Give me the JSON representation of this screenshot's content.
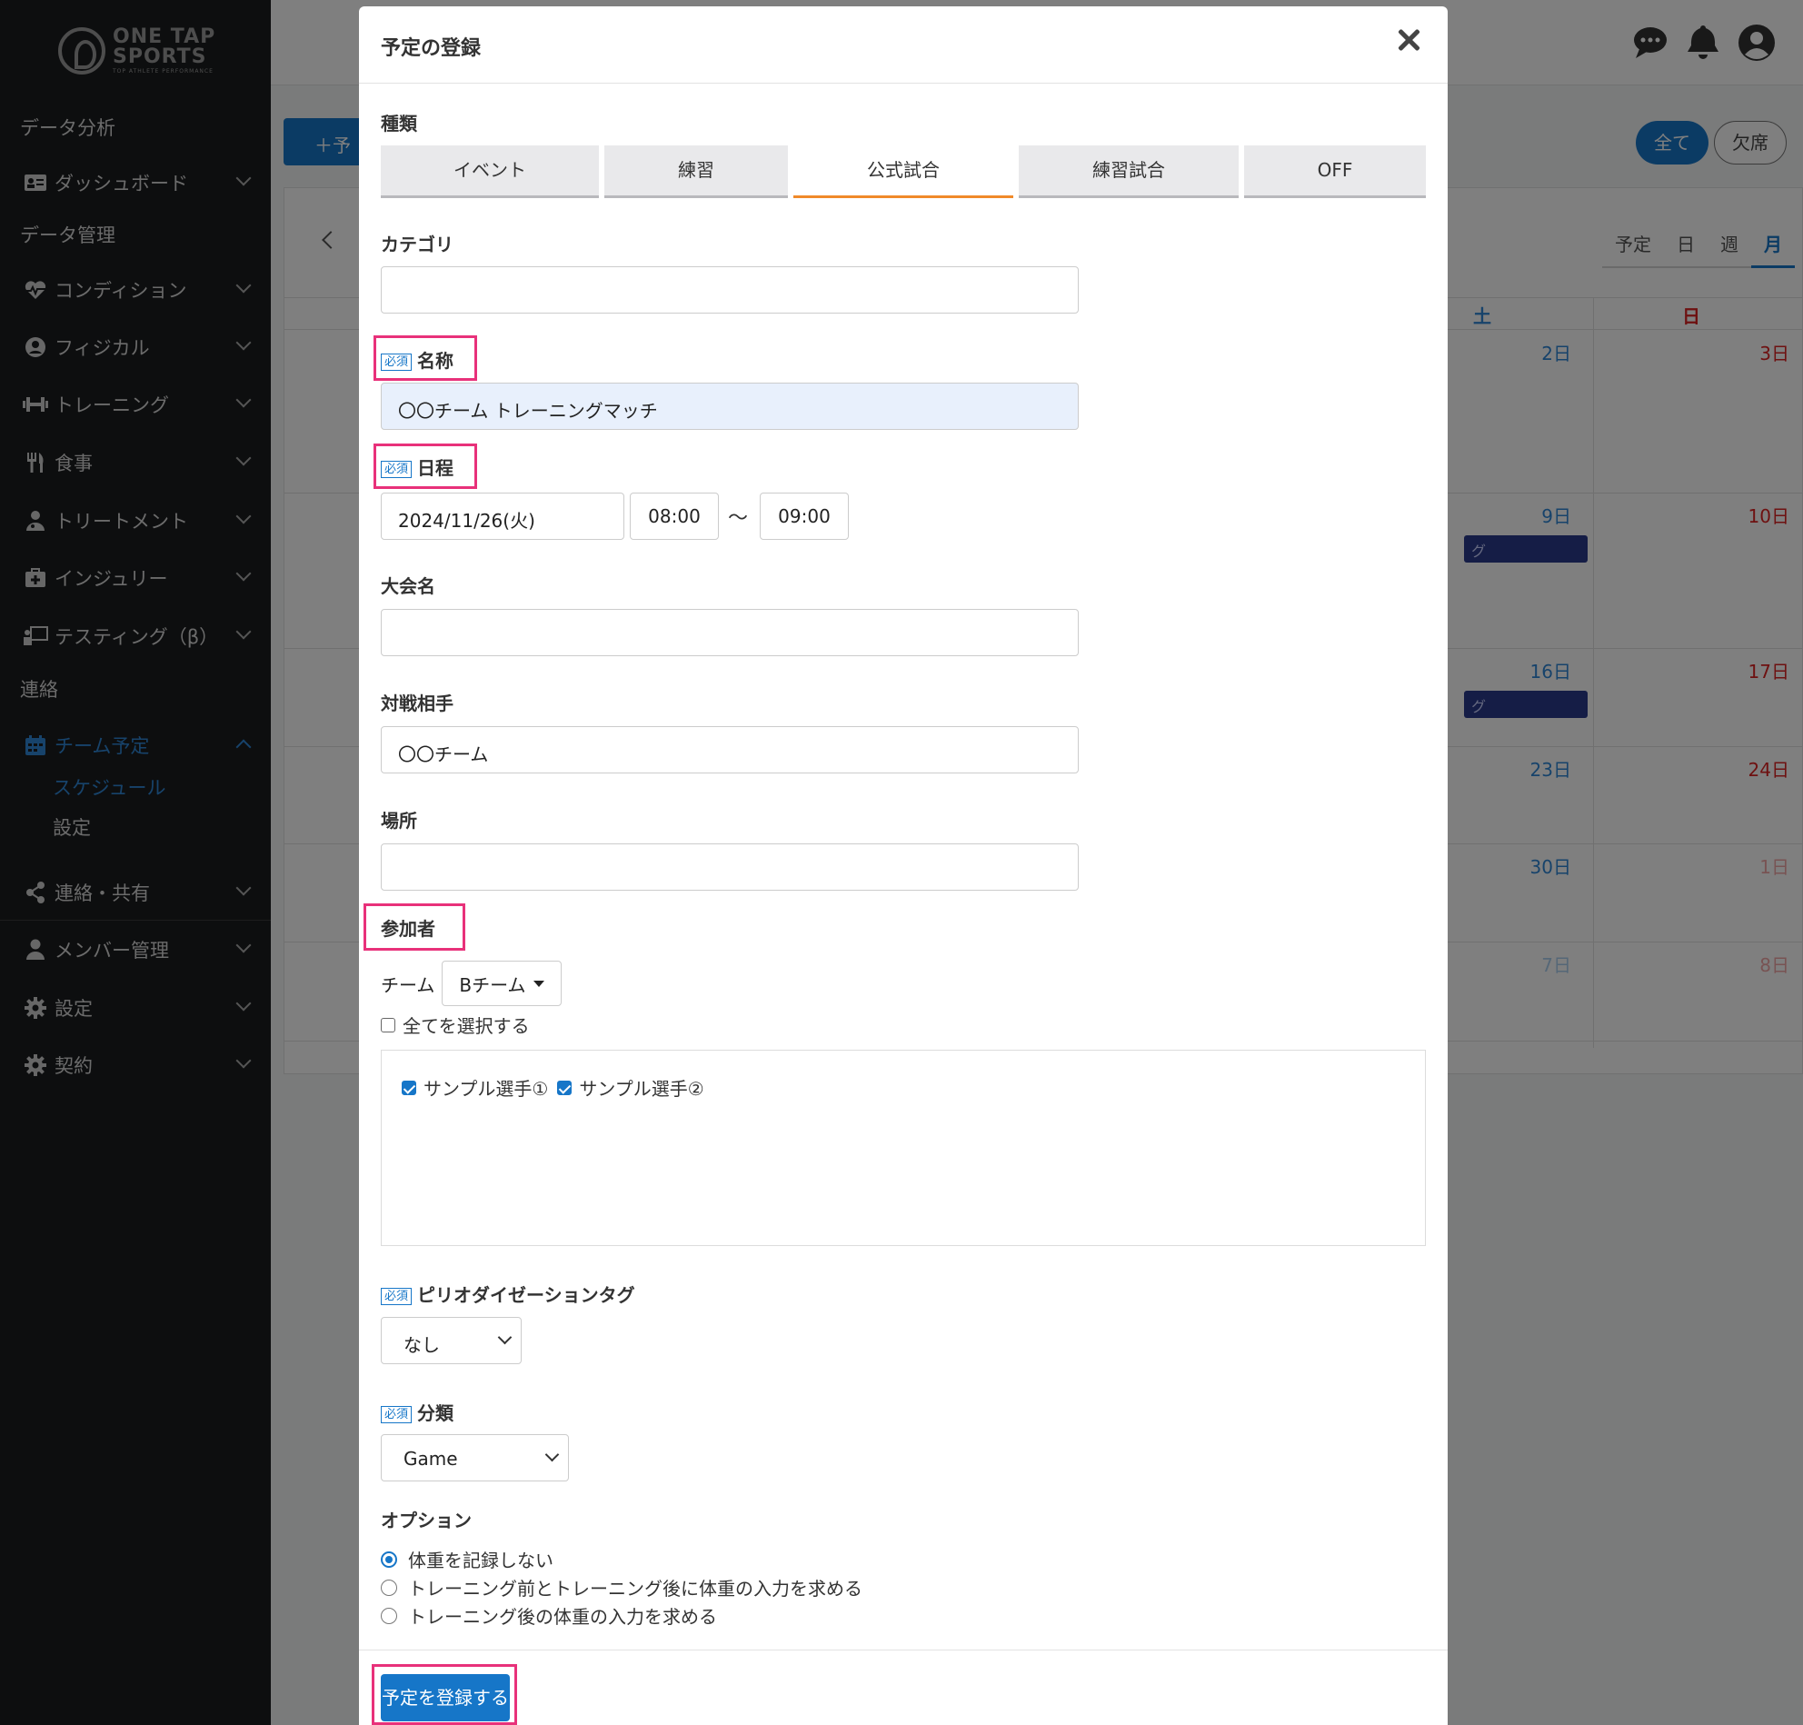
{
  "sidebar": {
    "logo": {
      "line1": "ONE TAP",
      "line2": "SPORTS",
      "tagline": "TOP ATHLETE PERFORMANCE"
    },
    "items": [
      {
        "label": "データ分析"
      },
      {
        "label": "ダッシュボード",
        "icon": "id-card-icon"
      },
      {
        "label": "データ管理"
      },
      {
        "label": "コンディション",
        "icon": "heartbeat-icon"
      },
      {
        "label": "フィジカル",
        "icon": "user-circle-icon"
      },
      {
        "label": "トレーニング",
        "icon": "dumbbell-icon"
      },
      {
        "label": "食事",
        "icon": "utensils-icon"
      },
      {
        "label": "トリートメント",
        "icon": "user-md-icon"
      },
      {
        "label": "インジュリー",
        "icon": "first-aid-icon"
      },
      {
        "label": "テスティング（β）",
        "icon": "chalkboard-icon"
      },
      {
        "label": "連絡"
      },
      {
        "label": "チーム予定",
        "icon": "calendar-icon"
      },
      {
        "label": "連絡・共有",
        "icon": "share-icon"
      },
      {
        "label": "メンバー管理",
        "icon": "user-icon"
      },
      {
        "label": "設定",
        "icon": "gear-icon"
      },
      {
        "label": "契約",
        "icon": "gear-icon"
      }
    ],
    "sub_items": [
      {
        "label": "スケジュール"
      },
      {
        "label": "設定"
      }
    ]
  },
  "topbar": {
    "icons": [
      "chat-icon",
      "bell-icon",
      "account-icon"
    ]
  },
  "background": {
    "add_button": "＋予",
    "filter_all": "全て",
    "filter_absent": "欠席",
    "view_tabs": [
      "予定",
      "日",
      "週",
      "月"
    ],
    "day_headers": {
      "sat": "土",
      "sun": "日"
    },
    "days": [
      {
        "sat": "2日",
        "sun": "3日"
      },
      {
        "sat": "9日",
        "sun": "10日"
      },
      {
        "sat": "16日",
        "sun": "17日"
      },
      {
        "sat": "23日",
        "sun": "24日"
      },
      {
        "sat": "30日",
        "sun": "1日"
      },
      {
        "sat": "7日",
        "sun": "8日"
      }
    ],
    "event_fragment": "グ"
  },
  "modal": {
    "title": "予定の登録",
    "type_label": "種類",
    "types": [
      "イベント",
      "練習",
      "公式試合",
      "練習試合",
      "OFF"
    ],
    "active_type": "公式試合",
    "category_label": "カテゴリ",
    "category_value": "",
    "required_badge": "必須",
    "name_label": "名称",
    "name_value": "〇〇チーム トレーニングマッチ",
    "schedule_label": "日程",
    "date_value": "2024/11/26(火)",
    "start_time": "08:00",
    "tilde": "〜",
    "end_time": "09:00",
    "tournament_label": "大会名",
    "opponent_label": "対戦相手",
    "opponent_value": "〇〇チーム",
    "place_label": "場所",
    "participants_label": "参加者",
    "team_label": "チーム",
    "team_value": "Bチーム",
    "select_all_label": "全てを選択する",
    "players": [
      "サンプル選手①",
      "サンプル選手②"
    ],
    "periodization_label": "ピリオダイゼーションタグ",
    "periodization_value": "なし",
    "classification_label": "分類",
    "classification_value": "Game",
    "options_label": "オプション",
    "options": [
      "体重を記録しない",
      "トレーニング前とトレーニング後に体重の入力を求める",
      "トレーニング後の体重の入力を求める"
    ],
    "submit_label": "予定を登録する"
  },
  "colors": {
    "accent": "#1676c8",
    "highlight": "#e8317a",
    "active_tab": "#f08a2a",
    "sidebar_bg": "#1b1d1f"
  }
}
